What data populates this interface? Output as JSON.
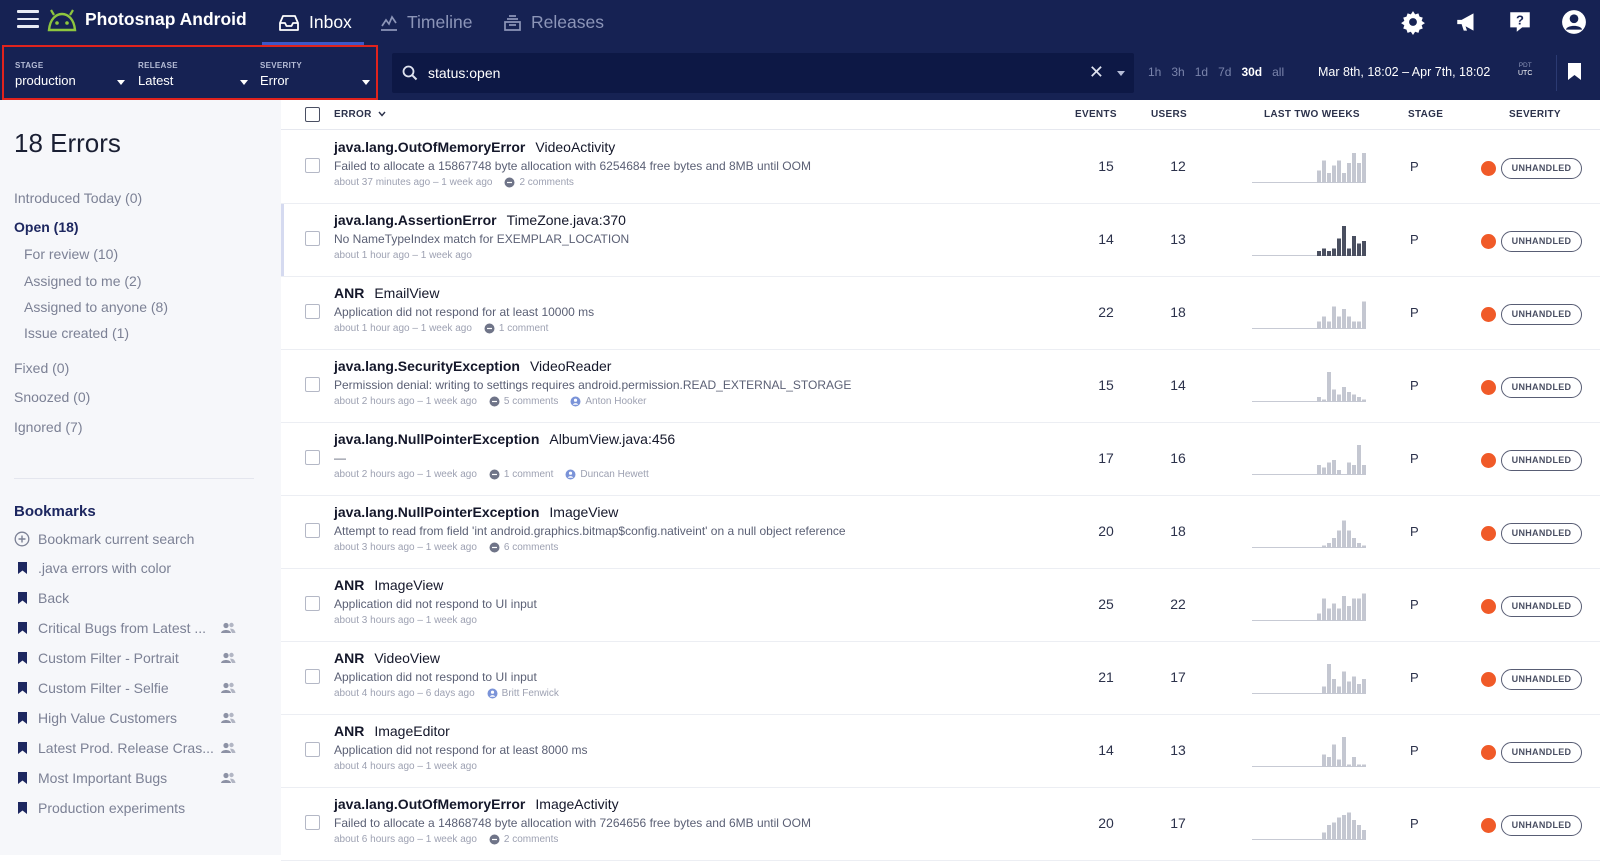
{
  "app": {
    "title": "Photosnap Android"
  },
  "nav": {
    "tabs": [
      {
        "label": "Inbox",
        "icon": "inbox-icon"
      },
      {
        "label": "Timeline",
        "icon": "timeline-icon"
      },
      {
        "label": "Releases",
        "icon": "releases-icon"
      }
    ]
  },
  "topicons": [
    "gear-icon",
    "megaphone-icon",
    "help-icon",
    "user-icon"
  ],
  "scope": {
    "stage": {
      "label": "STAGE",
      "value": "production"
    },
    "release": {
      "label": "RELEASE",
      "value": "Latest"
    },
    "severity": {
      "label": "SEVERITY",
      "value": "Error"
    }
  },
  "search": {
    "value": "status:open",
    "clear": "✕"
  },
  "ranges": [
    "1h",
    "3h",
    "1d",
    "7d",
    "30d",
    "all"
  ],
  "range_active": "30d",
  "daterange": "Mar 8th, 18:02 – Apr 7th, 18:02",
  "tz": {
    "top": "PDT",
    "bottom": "UTC"
  },
  "sidebar": {
    "count": "18 Errors",
    "introduced": "Introduced Today (0)",
    "open": "Open (18)",
    "review": "For review (10)",
    "assigned_me": "Assigned to me (2)",
    "assigned_any": "Assigned to anyone (8)",
    "issue_created": "Issue created (1)",
    "fixed": "Fixed (0)",
    "snoozed": "Snoozed (0)",
    "ignored": "Ignored (7)",
    "bookmarks_title": "Bookmarks",
    "bookmark_current": "Bookmark current search",
    "bookmarks": [
      {
        "label": ".java errors with color",
        "shared": false
      },
      {
        "label": "Back",
        "shared": false
      },
      {
        "label": "Critical Bugs from Latest ...",
        "shared": true
      },
      {
        "label": "Custom Filter - Portrait",
        "shared": true
      },
      {
        "label": "Custom Filter - Selfie",
        "shared": true
      },
      {
        "label": "High Value Customers",
        "shared": true
      },
      {
        "label": "Latest Prod. Release Cras...",
        "shared": true
      },
      {
        "label": "Most Important Bugs",
        "shared": true
      },
      {
        "label": "Production experiments",
        "shared": false
      }
    ]
  },
  "table": {
    "headers": {
      "error": "ERROR",
      "events": "EVENTS",
      "users": "USERS",
      "trend": "LAST TWO WEEKS",
      "stage": "STAGE",
      "severity": "SEVERITY"
    },
    "badge": "UNHANDLED",
    "rows": [
      {
        "cls": "java.lang.OutOfMemoryError",
        "loc": "VideoActivity",
        "msg": "Failed to allocate a 15867748 byte allocation with 6254684 free bytes and 8MB until OOM",
        "time": "about 37 minutes ago – 1 week ago",
        "comments": "2 comments",
        "user": "",
        "events": "15",
        "users": "12",
        "stage": "P",
        "spark": [
          0,
          0,
          0,
          0,
          0,
          0,
          0,
          0,
          0,
          0,
          0,
          0,
          0,
          5,
          9,
          4,
          7,
          9,
          4,
          8,
          12,
          8,
          12
        ],
        "dark": false
      },
      {
        "cls": "java.lang.AssertionError",
        "loc": "TimeZone.java:370",
        "msg": "No NameTypeIndex match for EXEMPLAR_LOCATION",
        "time": "about 1 hour ago – 1 week ago",
        "comments": "",
        "user": "",
        "events": "14",
        "users": "13",
        "stage": "P",
        "spark": [
          0,
          0,
          0,
          0,
          0,
          0,
          0,
          0,
          0,
          0,
          0,
          0,
          0,
          2,
          3,
          2,
          3,
          7,
          12,
          3,
          8,
          5,
          6
        ],
        "dark": true
      },
      {
        "cls": "ANR",
        "loc": "EmailView",
        "msg": "Application did not respond for at least 10000 ms",
        "time": "about 1 hour ago – 1 week ago",
        "comments": "1 comment",
        "user": "",
        "events": "22",
        "users": "18",
        "stage": "P",
        "spark": [
          0,
          0,
          0,
          0,
          0,
          0,
          0,
          0,
          0,
          0,
          0,
          0,
          0,
          3,
          5,
          3,
          9,
          5,
          8,
          5,
          3,
          3,
          11
        ],
        "dark": false
      },
      {
        "cls": "java.lang.SecurityException",
        "loc": "VideoReader",
        "msg": "Permission denial: writing to settings requires android.permission.READ_EXTERNAL_STORAGE",
        "time": "about 2 hours ago – 1 week ago",
        "comments": "5 comments",
        "user": "Anton Hooker",
        "events": "15",
        "users": "14",
        "stage": "P",
        "spark": [
          0,
          0,
          0,
          0,
          0,
          0,
          0,
          0,
          0,
          0,
          0,
          0,
          0,
          2,
          1,
          12,
          5,
          3,
          6,
          4,
          3,
          2,
          1
        ],
        "dark": false
      },
      {
        "cls": "java.lang.NullPointerException",
        "loc": "AlbumView.java:456",
        "msg": "—",
        "time": "about 2 hours ago – 1 week ago",
        "comments": "1 comment",
        "user": "Duncan Hewett",
        "events": "17",
        "users": "16",
        "stage": "P",
        "spark": [
          0,
          0,
          0,
          0,
          0,
          0,
          0,
          0,
          0,
          0,
          0,
          0,
          0,
          4,
          3,
          5,
          6,
          2,
          0,
          5,
          4,
          12,
          4
        ],
        "dark": false
      },
      {
        "cls": "java.lang.NullPointerException",
        "loc": "ImageView",
        "msg": "Attempt to read from field 'int android.graphics.bitmap$config.nativeint' on a null object reference",
        "time": "about 3 hours ago – 1 week ago",
        "comments": "6 comments",
        "user": "",
        "events": "20",
        "users": "18",
        "stage": "P",
        "spark": [
          0,
          0,
          0,
          0,
          0,
          0,
          0,
          0,
          0,
          0,
          0,
          0,
          0,
          0,
          1,
          2,
          4,
          7,
          11,
          7,
          4,
          2,
          1
        ],
        "dark": false
      },
      {
        "cls": "ANR",
        "loc": "ImageView",
        "msg": "Application did not respond to UI input",
        "time": "about 3 hours ago – 1 week ago",
        "comments": "",
        "user": "",
        "events": "25",
        "users": "22",
        "stage": "P",
        "spark": [
          0,
          0,
          0,
          0,
          0,
          0,
          0,
          0,
          0,
          0,
          0,
          0,
          0,
          3,
          9,
          5,
          7,
          5,
          10,
          6,
          9,
          9,
          11
        ],
        "dark": false
      },
      {
        "cls": "ANR",
        "loc": "VideoView",
        "msg": "Application did not respond to UI input",
        "time": "about 4 hours ago – 6 days ago",
        "comments": "",
        "user": "Britt Fenwick",
        "events": "21",
        "users": "17",
        "stage": "P",
        "spark": [
          0,
          0,
          0,
          0,
          0,
          0,
          0,
          0,
          0,
          0,
          0,
          0,
          0,
          0,
          3,
          12,
          6,
          3,
          9,
          5,
          7,
          4,
          6
        ],
        "dark": false
      },
      {
        "cls": "ANR",
        "loc": "ImageEditor",
        "msg": "Application did not respond for at least 8000 ms",
        "time": "about 4 hours ago – 1 week ago",
        "comments": "",
        "user": "",
        "events": "14",
        "users": "13",
        "stage": "P",
        "spark": [
          0,
          0,
          0,
          0,
          0,
          0,
          0,
          0,
          0,
          0,
          0,
          0,
          0,
          0,
          5,
          4,
          9,
          3,
          12,
          1,
          4,
          1,
          1
        ],
        "dark": false
      },
      {
        "cls": "java.lang.OutOfMemoryError",
        "loc": "ImageActivity",
        "msg": "Failed to allocate a 14868748 byte allocation with 7264656 free bytes and 6MB until OOM",
        "time": "about 6 hours ago – 1 week ago",
        "comments": "2 comments",
        "user": "",
        "events": "20",
        "users": "17",
        "stage": "P",
        "spark": [
          0,
          0,
          0,
          0,
          0,
          0,
          0,
          0,
          0,
          0,
          0,
          0,
          0,
          0,
          3,
          6,
          7,
          9,
          10,
          11,
          8,
          6,
          4
        ],
        "dark": false
      }
    ]
  },
  "colors": {
    "nav_bg": "#162253",
    "search_bg": "#0d1845",
    "scope_border": "#e0231d",
    "severity_error": "#f05a28",
    "accent": "#3c58c8"
  }
}
